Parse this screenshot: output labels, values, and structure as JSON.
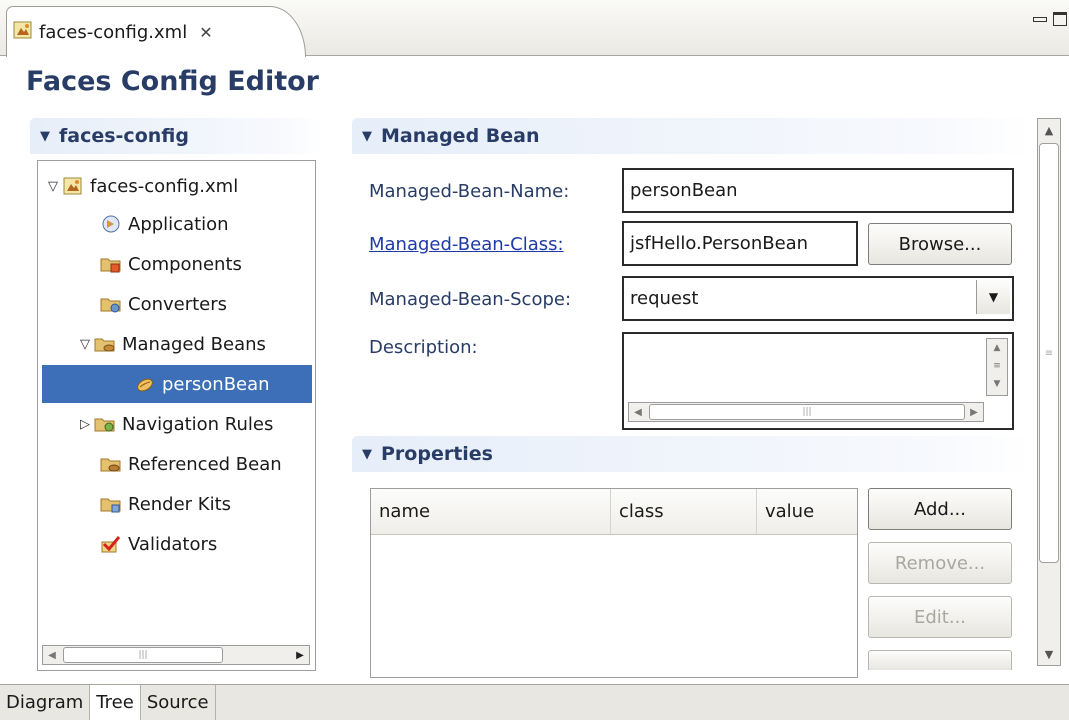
{
  "editor_tab": {
    "title": "faces-config.xml",
    "close_glyph": "✕"
  },
  "editor": {
    "title": "Faces Config Editor"
  },
  "tree_section": {
    "title": "faces-config",
    "items": [
      {
        "label": "faces-config.xml",
        "icon": "xml-file-icon",
        "twisty": "▽"
      },
      {
        "label": "Application",
        "icon": "application-icon",
        "twisty": ""
      },
      {
        "label": "Components",
        "icon": "components-folder-icon",
        "twisty": ""
      },
      {
        "label": "Converters",
        "icon": "converters-folder-icon",
        "twisty": ""
      },
      {
        "label": "Managed Beans",
        "icon": "managed-beans-folder-icon",
        "twisty": "▽"
      },
      {
        "label": "personBean",
        "icon": "bean-icon",
        "twisty": ""
      },
      {
        "label": "Navigation Rules",
        "icon": "navigation-folder-icon",
        "twisty": "▷"
      },
      {
        "label": "Referenced Bean",
        "icon": "referenced-bean-folder-icon",
        "twisty": ""
      },
      {
        "label": "Render Kits",
        "icon": "render-kits-folder-icon",
        "twisty": ""
      },
      {
        "label": "Validators",
        "icon": "validators-icon",
        "twisty": ""
      }
    ],
    "selected_index": 5
  },
  "managed_bean_section": {
    "title": "Managed Bean",
    "name_label": "Managed-Bean-Name:",
    "name_value": "personBean",
    "class_label": "Managed-Bean-Class:",
    "class_value": "jsfHello.PersonBean",
    "browse_label": "Browse...",
    "scope_label": "Managed-Bean-Scope:",
    "scope_value": "request",
    "description_label": "Description:",
    "description_value": ""
  },
  "properties_section": {
    "title": "Properties",
    "columns": [
      "name",
      "class",
      "value"
    ],
    "rows": [],
    "add_label": "Add...",
    "remove_label": "Remove...",
    "edit_label": "Edit..."
  },
  "bottom_tabs": [
    {
      "label": "Diagram",
      "active": false
    },
    {
      "label": "Tree",
      "active": true
    },
    {
      "label": "Source",
      "active": false
    }
  ],
  "colors": {
    "heading": "#283c66",
    "selection": "#3c6fb8",
    "link": "#1f3aa8"
  }
}
